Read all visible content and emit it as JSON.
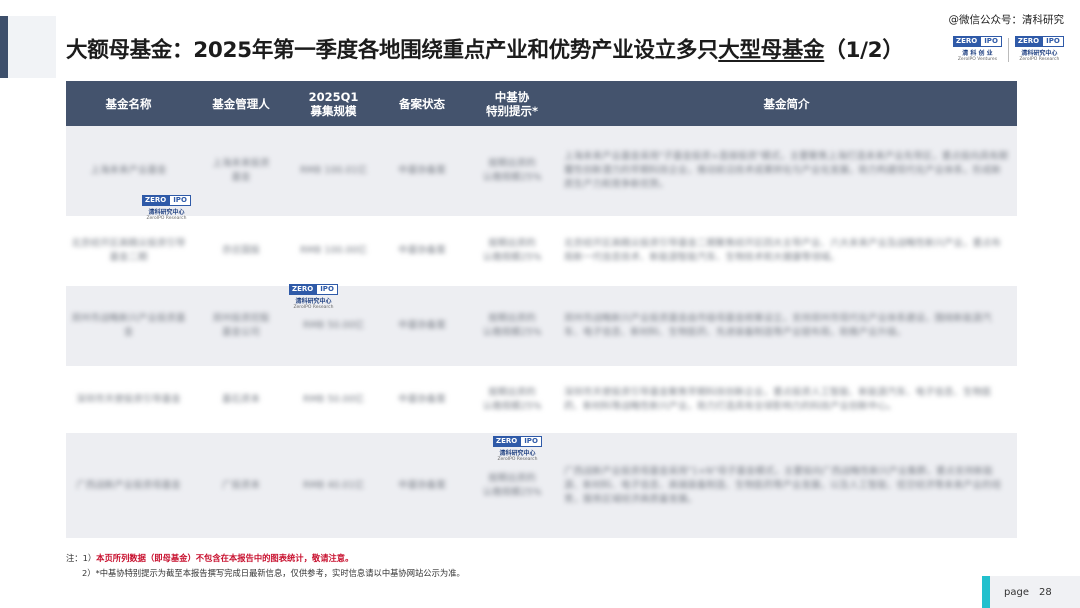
{
  "header": {
    "title_part1": "大额母基金：2025年第一季度各地围绕重点产业和优势产业设立多只",
    "title_underlined": "大型母基金",
    "title_part2": "（1/2）",
    "watermark": "@微信公众号：清科研究"
  },
  "logos": {
    "zero": "ZERO",
    "ipo": "IPO",
    "cn": "清科研究中心",
    "en": "ZeroIPO Research",
    "top_left_cn": "清 科 创 业",
    "top_left_en": "ZeroIPO Ventures"
  },
  "table": {
    "headers": [
      "基金名称",
      "基金管理人",
      "2025Q1\n募集规模",
      "备案状态",
      "中基协\n特别提示*",
      "基金简介"
    ],
    "rows": [
      {
        "name": "上海未来产业基金",
        "manager": "上海未来投资\n基金",
        "scale": "RMB 100.01亿",
        "status": "中基协备案",
        "tip": "按期出资的\n认缴规模25%",
        "desc": "上海未来产业基金采用\"子基金投资+直接投资\"模式，主要聚焦上海打造未来产业先导区，重点投向具有颠覆性创新潜力的早期科技企业，推动前沿技术成果转化与产业化发展，助力构建现代化产业体系，形成新质生产力和竞争新优势。"
      },
      {
        "name": "北京经开区高精尖投资引导基金二期",
        "manager": "亦庄国投",
        "scale": "RMB 100.00亿",
        "status": "中基协备案",
        "tip": "按期出资的\n认缴规模25%",
        "desc": "北京经开区高精尖投资引导基金二期聚焦经开区四大主导产业、六大未来产业及战略性新兴产业，重点布局新一代信息技术、新能源智能汽车、生物技术和大健康等领域。"
      },
      {
        "name": "郑州市战略新兴产业投资基金",
        "manager": "郑州投资控股\n基金公司",
        "scale": "RMB 50.00亿",
        "status": "中基协备案",
        "tip": "按期出资的\n认缴规模25%",
        "desc": "郑州市战略新兴产业投资基金由市级母基金统筹设立，支持郑州市现代化产业体系建设，围绕新能源汽车、电子信息、新材料、生物医药、先进装备制造等产业链布局，助推产业升级。"
      },
      {
        "name": "深圳市天使投资引导基金",
        "manager": "基石资本",
        "scale": "RMB 50.00亿",
        "status": "中基协备案",
        "tip": "按期出资的\n认缴规模25%",
        "desc": "深圳市天使投资引导基金聚焦早期科技创新企业，重点投资人工智能、新能源汽车、电子信息、生物医药、新材料等战略性新兴产业，助力打造具有全球影响力的科技产业创新中心。"
      },
      {
        "name": "广西战新产业投资母基金",
        "manager": "广投资本",
        "scale": "RMB 40.01亿",
        "status": "中基协备案",
        "tip": "按期出资的\n认缴规模25%",
        "desc": "广西战新产业投资母基金采用\"1+N\"母子基金模式，主要投向广西战略性新兴产业集群，重点支持新能源、新材料、电子信息、高端装备制造、生物医药等产业发展，以及人工智能、低空经济等未来产业的培育，服务区域经济高质量发展。"
      }
    ]
  },
  "notes": {
    "n1_prefix": "注：1）",
    "n1_red": "本页所列数据（即母基金）不包含在本报告中的图表统计，敬请注意。",
    "n2": "2）*中基协特别提示为截至本报告撰写完成日最新信息，仅供参考，实时信息请以中基协网站公示为准。"
  },
  "footer": {
    "page_label": "page",
    "page_number": "28"
  }
}
